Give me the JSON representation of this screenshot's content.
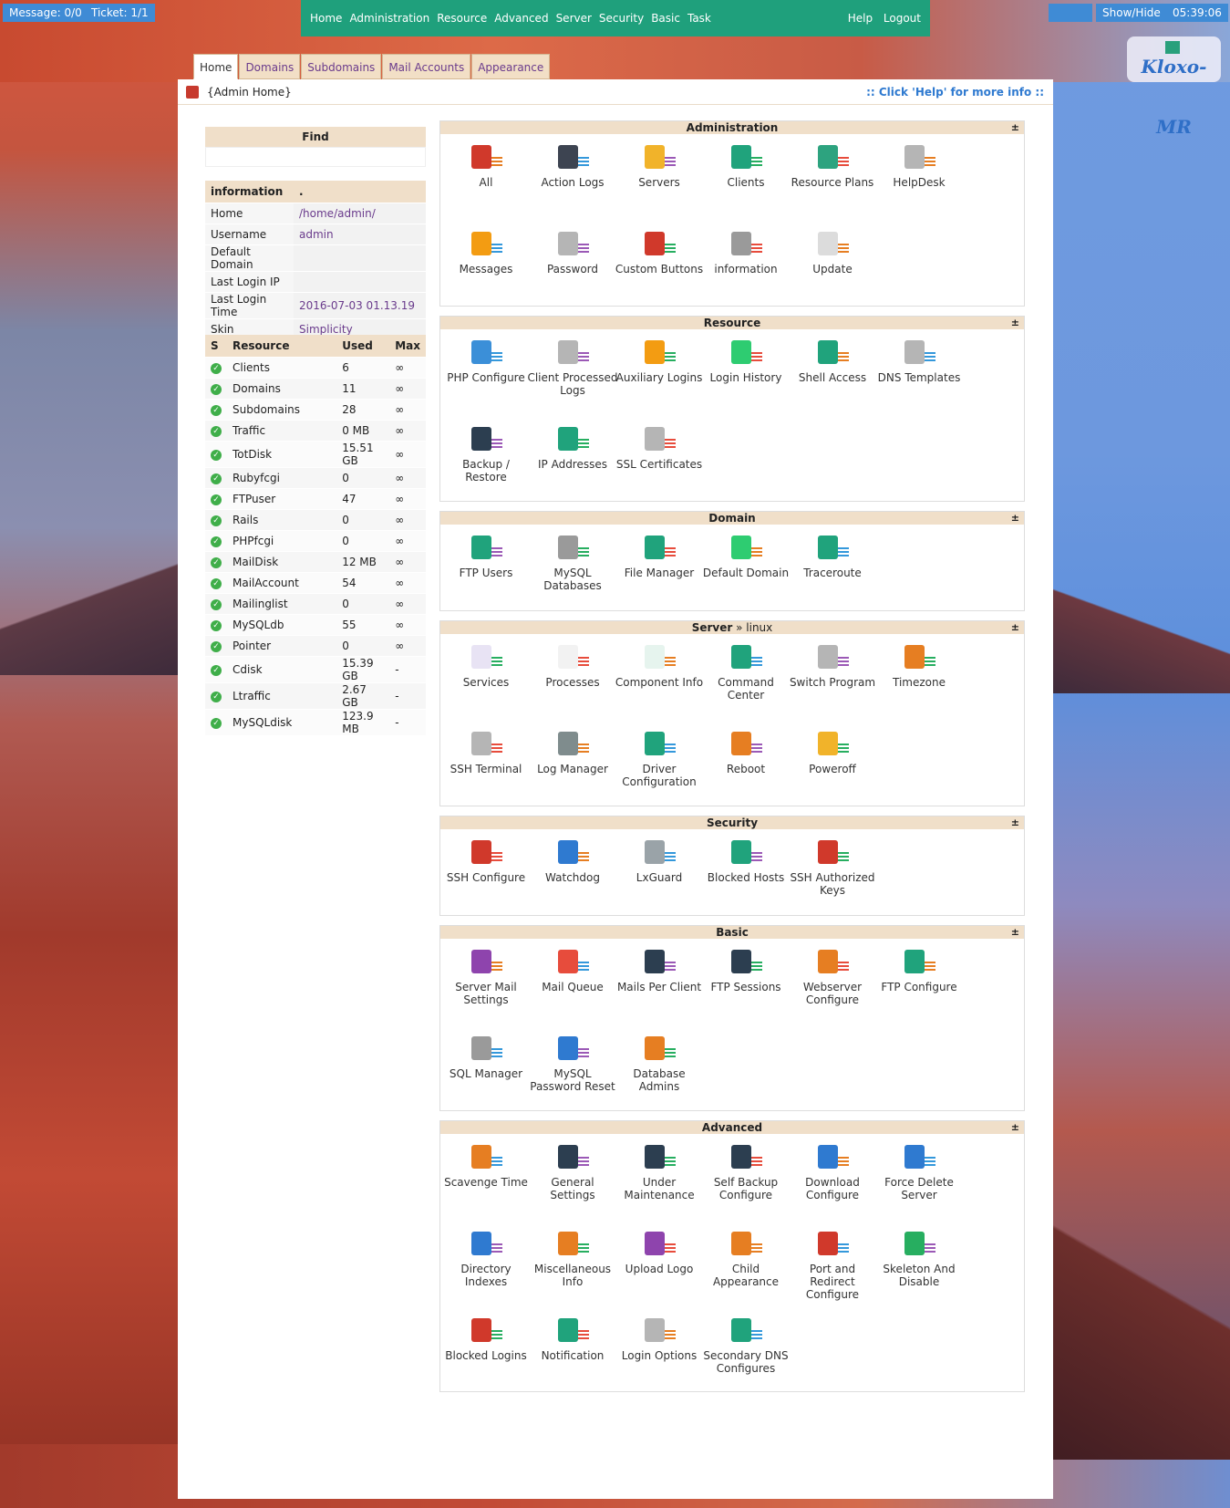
{
  "topbar": {
    "message": "Message: 0/0",
    "ticket": "Ticket: 1/1",
    "menu": [
      "Home",
      "Administration",
      "Resource",
      "Advanced",
      "Server",
      "Security",
      "Basic",
      "Task"
    ],
    "help": "Help",
    "logout": "Logout",
    "showhide": "Show/Hide",
    "clock": "05:39:06"
  },
  "logo": "Kloxo-MR",
  "tabs": [
    "Home",
    "Domains",
    "Subdomains",
    "Mail Accounts",
    "Appearance"
  ],
  "crumb": {
    "title": "{Admin Home}",
    "help": ":: Click 'Help' for more info ::"
  },
  "find": {
    "label": "Find"
  },
  "info": {
    "header": [
      "information",
      "."
    ],
    "rows": [
      {
        "k": "Home",
        "v": "/home/admin/"
      },
      {
        "k": "Username",
        "v": "admin"
      },
      {
        "k": "Default Domain",
        "v": ""
      },
      {
        "k": "Last Login IP",
        "v": ""
      },
      {
        "k": "Last Login Time",
        "v": "2016-07-03 01.13.19"
      },
      {
        "k": "Skin",
        "v": "Simplicity"
      }
    ]
  },
  "resources": {
    "header": [
      "S",
      "Resource",
      "Used",
      "Max"
    ],
    "rows": [
      {
        "name": "Clients",
        "used": "6",
        "max": "∞"
      },
      {
        "name": "Domains",
        "used": "11",
        "max": "∞"
      },
      {
        "name": "Subdomains",
        "used": "28",
        "max": "∞"
      },
      {
        "name": "Traffic",
        "used": "0 MB",
        "max": "∞"
      },
      {
        "name": "TotDisk",
        "used": "15.51 GB",
        "max": "∞"
      },
      {
        "name": "Rubyfcgi",
        "used": "0",
        "max": "∞"
      },
      {
        "name": "FTPuser",
        "used": "47",
        "max": "∞"
      },
      {
        "name": "Rails",
        "used": "0",
        "max": "∞"
      },
      {
        "name": "PHPfcgi",
        "used": "0",
        "max": "∞"
      },
      {
        "name": "MailDisk",
        "used": "12 MB",
        "max": "∞"
      },
      {
        "name": "MailAccount",
        "used": "54",
        "max": "∞"
      },
      {
        "name": "Mailinglist",
        "used": "0",
        "max": "∞"
      },
      {
        "name": "MySQLdb",
        "used": "55",
        "max": "∞"
      },
      {
        "name": "Pointer",
        "used": "0",
        "max": "∞"
      },
      {
        "name": "Cdisk",
        "used": "15.39 GB",
        "max": "-"
      },
      {
        "name": "Ltraffic",
        "used": "2.67 GB",
        "max": "-"
      },
      {
        "name": "MySQLdisk",
        "used": "123.9 MB",
        "max": "-"
      }
    ]
  },
  "sections": [
    {
      "title": "Administration",
      "sub": "",
      "items": [
        {
          "label": "All",
          "icon": "users-icon",
          "color": "#d0392b"
        },
        {
          "label": "Action Logs",
          "icon": "log-icon",
          "color": "#3d4451"
        },
        {
          "label": "Servers",
          "icon": "server-icon",
          "color": "#f1b32a"
        },
        {
          "label": "Clients",
          "icon": "client-icon",
          "color": "#20a37c"
        },
        {
          "label": "Resource Plans",
          "icon": "plans-icon",
          "color": "#2da37f"
        },
        {
          "label": "HelpDesk",
          "icon": "helpdesk-icon",
          "color": "#b5b5b5"
        },
        {
          "label": "Messages",
          "icon": "message-icon",
          "color": "#f39c12"
        },
        {
          "label": "Password",
          "icon": "password-icon",
          "color": "#b5b5b5"
        },
        {
          "label": "Custom Buttons",
          "icon": "buttons-icon",
          "color": "#d0392b"
        },
        {
          "label": "information",
          "icon": "info-icon",
          "color": "#9a9a9a"
        },
        {
          "label": "Update",
          "icon": "update-icon",
          "color": "#dcdcdc"
        }
      ]
    },
    {
      "title": "Resource",
      "sub": "",
      "items": [
        {
          "label": "PHP Configure",
          "icon": "php-icon",
          "color": "#3b8fd8"
        },
        {
          "label": "Client Processed Logs",
          "icon": "logs-icon",
          "color": "#b5b5b5"
        },
        {
          "label": "Auxiliary Logins",
          "icon": "aux-icon",
          "color": "#f39c12"
        },
        {
          "label": "Login History",
          "icon": "history-icon",
          "color": "#2ecc71"
        },
        {
          "label": "Shell Access",
          "icon": "shell-icon",
          "color": "#20a37c"
        },
        {
          "label": "DNS Templates",
          "icon": "dns-icon",
          "color": "#b5b5b5"
        },
        {
          "label": "Backup / Restore",
          "icon": "backup-icon",
          "color": "#2c3e50"
        },
        {
          "label": "IP Addresses",
          "icon": "ip-icon",
          "color": "#20a37c"
        },
        {
          "label": "SSL Certificates",
          "icon": "ssl-icon",
          "color": "#b5b5b5"
        }
      ]
    },
    {
      "title": "Domain",
      "sub": "",
      "items": [
        {
          "label": "FTP Users",
          "icon": "ftp-icon",
          "color": "#20a37c"
        },
        {
          "label": "MySQL Databases",
          "icon": "mysql-icon",
          "color": "#9a9a9a"
        },
        {
          "label": "File Manager",
          "icon": "folder-icon",
          "color": "#20a37c"
        },
        {
          "label": "Default Domain",
          "icon": "domain-icon",
          "color": "#2ecc71"
        },
        {
          "label": "Traceroute",
          "icon": "trace-icon",
          "color": "#20a37c"
        }
      ]
    },
    {
      "title": "Server",
      "sub": " » linux",
      "items": [
        {
          "label": "Services",
          "icon": "services-icon",
          "color": "#e8e3f4"
        },
        {
          "label": "Processes",
          "icon": "processes-icon",
          "color": "#f2f2f2"
        },
        {
          "label": "Component Info",
          "icon": "component-icon",
          "color": "#e6f4ee"
        },
        {
          "label": "Command Center",
          "icon": "command-icon",
          "color": "#20a37c"
        },
        {
          "label": "Switch Program",
          "icon": "switch-icon",
          "color": "#b5b5b5"
        },
        {
          "label": "Timezone",
          "icon": "timezone-icon",
          "color": "#e67e22"
        },
        {
          "label": "SSH Terminal",
          "icon": "terminal-icon",
          "color": "#b5b5b5"
        },
        {
          "label": "Log Manager",
          "icon": "logmgr-icon",
          "color": "#7f8c8d"
        },
        {
          "label": "Driver Configuration",
          "icon": "driver-icon",
          "color": "#20a37c"
        },
        {
          "label": "Reboot",
          "icon": "reboot-icon",
          "color": "#e67e22"
        },
        {
          "label": "Poweroff",
          "icon": "poweroff-icon",
          "color": "#f1b32a"
        }
      ]
    },
    {
      "title": "Security",
      "sub": "",
      "items": [
        {
          "label": "SSH Configure",
          "icon": "sshcfg-icon",
          "color": "#d0392b"
        },
        {
          "label": "Watchdog",
          "icon": "watchdog-icon",
          "color": "#2f7ad0"
        },
        {
          "label": "LxGuard",
          "icon": "shield-icon",
          "color": "#9aa3a8"
        },
        {
          "label": "Blocked Hosts",
          "icon": "block-icon",
          "color": "#20a37c"
        },
        {
          "label": "SSH Authorized Keys",
          "icon": "keys-icon",
          "color": "#d0392b"
        }
      ]
    },
    {
      "title": "Basic",
      "sub": "",
      "items": [
        {
          "label": "Server Mail Settings",
          "icon": "mailsrv-icon",
          "color": "#8e44ad"
        },
        {
          "label": "Mail Queue",
          "icon": "mailq-icon",
          "color": "#e74c3c"
        },
        {
          "label": "Mails Per Client",
          "icon": "mpc-icon",
          "color": "#2c3e50"
        },
        {
          "label": "FTP Sessions",
          "icon": "ftps-icon",
          "color": "#2c3e50"
        },
        {
          "label": "Webserver Configure",
          "icon": "websrv-icon",
          "color": "#e67e22"
        },
        {
          "label": "FTP Configure",
          "icon": "ftpcfg-icon",
          "color": "#20a37c"
        },
        {
          "label": "SQL Manager",
          "icon": "sql-icon",
          "color": "#9a9a9a"
        },
        {
          "label": "MySQL Password Reset",
          "icon": "mysqlpw-icon",
          "color": "#2f7ad0"
        },
        {
          "label": "Database Admins",
          "icon": "dbadmin-icon",
          "color": "#e67e22"
        }
      ]
    },
    {
      "title": "Advanced",
      "sub": "",
      "items": [
        {
          "label": "Scavenge Time",
          "icon": "scavenge-icon",
          "color": "#e67e22"
        },
        {
          "label": "General Settings",
          "icon": "settings-icon",
          "color": "#2c3e50"
        },
        {
          "label": "Under Maintenance",
          "icon": "maint-icon",
          "color": "#2c3e50"
        },
        {
          "label": "Self Backup Configure",
          "icon": "selfbackup-icon",
          "color": "#2c3e50"
        },
        {
          "label": "Download Configure",
          "icon": "download-icon",
          "color": "#2f7ad0"
        },
        {
          "label": "Force Delete Server",
          "icon": "forcedel-icon",
          "color": "#2f7ad0"
        },
        {
          "label": "Directory Indexes",
          "icon": "dirindex-icon",
          "color": "#2f7ad0"
        },
        {
          "label": "Miscellaneous Info",
          "icon": "misc-icon",
          "color": "#e67e22"
        },
        {
          "label": "Upload Logo",
          "icon": "upload-icon",
          "color": "#8e44ad"
        },
        {
          "label": "Child Appearance",
          "icon": "appearance-icon",
          "color": "#e67e22"
        },
        {
          "label": "Port and Redirect Configure",
          "icon": "port-icon",
          "color": "#d0392b"
        },
        {
          "label": "Skeleton And Disable",
          "icon": "skeleton-icon",
          "color": "#27ae60"
        },
        {
          "label": "Blocked Logins",
          "icon": "blocklogin-icon",
          "color": "#d0392b"
        },
        {
          "label": "Notification",
          "icon": "notify-icon",
          "color": "#20a37c"
        },
        {
          "label": "Login Options",
          "icon": "loginopt-icon",
          "color": "#b5b5b5"
        },
        {
          "label": "Secondary DNS Configures",
          "icon": "secdns-icon",
          "color": "#20a37c"
        }
      ]
    }
  ]
}
